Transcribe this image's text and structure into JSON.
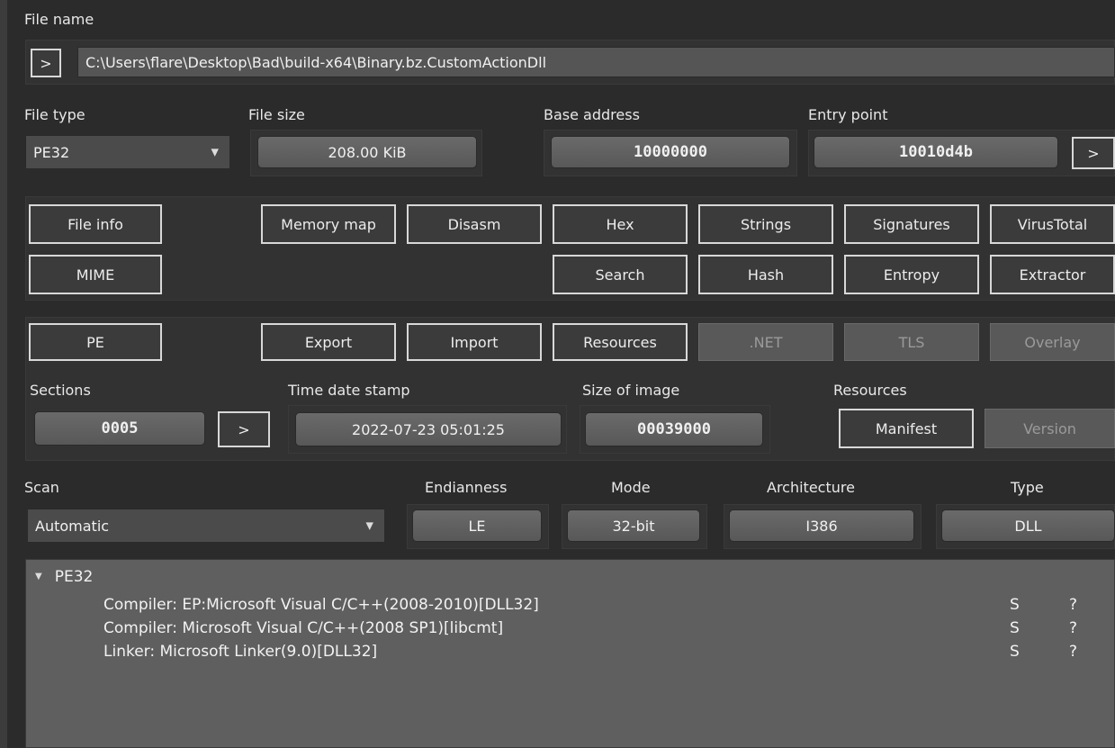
{
  "file_name": {
    "label": "File name",
    "open_button": ">",
    "path": "C:\\Users\\flare\\Desktop\\Bad\\build-x64\\Binary.bz.CustomActionDll"
  },
  "file_type": {
    "label": "File type",
    "value": "PE32"
  },
  "file_size": {
    "label": "File size",
    "value": "208.00 KiB"
  },
  "base_address": {
    "label": "Base address",
    "value": "10000000"
  },
  "entry_point": {
    "label": "Entry point",
    "value": "10010d4b",
    "button": ">"
  },
  "tools_row1": {
    "file_info": "File info",
    "memory_map": "Memory map",
    "disasm": "Disasm",
    "hex": "Hex",
    "strings": "Strings",
    "signatures": "Signatures",
    "virustotal": "VirusTotal"
  },
  "tools_row2": {
    "mime": "MIME",
    "search": "Search",
    "hash": "Hash",
    "entropy": "Entropy",
    "extractor": "Extractor"
  },
  "pe_row": {
    "pe": "PE",
    "export": "Export",
    "import": "Import",
    "resources": "Resources",
    "net": ".NET",
    "tls": "TLS",
    "overlay": "Overlay"
  },
  "sections": {
    "label": "Sections",
    "value": "0005",
    "button": ">"
  },
  "time_date_stamp": {
    "label": "Time date stamp",
    "value": "2022-07-23 05:01:25"
  },
  "size_of_image": {
    "label": "Size of image",
    "value": "00039000"
  },
  "resources_group": {
    "label": "Resources",
    "manifest": "Manifest",
    "version": "Version"
  },
  "scan": {
    "label": "Scan",
    "value": "Automatic"
  },
  "endianness": {
    "label": "Endianness",
    "value": "LE"
  },
  "mode": {
    "label": "Mode",
    "value": "32-bit"
  },
  "architecture": {
    "label": "Architecture",
    "value": "I386"
  },
  "type": {
    "label": "Type",
    "value": "DLL"
  },
  "results": {
    "root": "PE32",
    "items": [
      {
        "text": "Compiler: EP:Microsoft Visual C/C++(2008-2010)[DLL32]",
        "flag": "S",
        "info": "?"
      },
      {
        "text": "Compiler: Microsoft Visual C/C++(2008 SP1)[libcmt]",
        "flag": "S",
        "info": "?"
      },
      {
        "text": "Linker: Microsoft Linker(9.0)[DLL32]",
        "flag": "S",
        "info": "?"
      }
    ]
  }
}
